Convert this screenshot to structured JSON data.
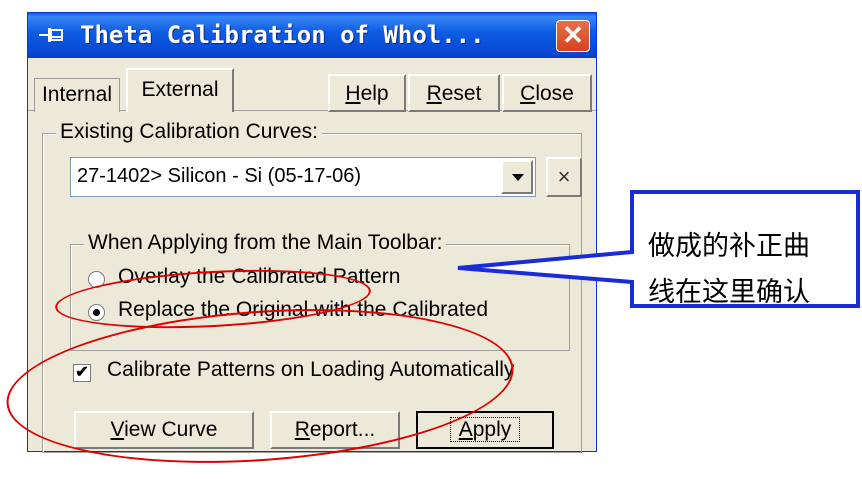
{
  "window": {
    "title": "Theta Calibration of Whol...",
    "close_glyph": "✕"
  },
  "tabs": [
    {
      "label": "Internal",
      "active": false
    },
    {
      "label": "External",
      "active": true
    }
  ],
  "toolbar": {
    "help": {
      "label_underline": "H",
      "label_rest": "elp"
    },
    "reset": {
      "label_underline": "R",
      "label_rest": "eset"
    },
    "close": {
      "label_underline": "C",
      "label_rest": "lose"
    }
  },
  "existing_group": {
    "label": "Existing Calibration Curves:",
    "selected_curve": "27-1402> Silicon - Si (05-17-06)",
    "clear_glyph": "×"
  },
  "apply_group": {
    "label": "When Applying from the Main Toolbar:",
    "options": [
      {
        "label": "Overlay the Calibrated Pattern",
        "selected": false
      },
      {
        "label": "Replace the Original with the Calibrated",
        "selected": true
      }
    ]
  },
  "auto_calibrate": {
    "label": "Calibrate Patterns on Loading Automatically",
    "checked": true,
    "check_glyph": "✔"
  },
  "buttons": {
    "view_curve": {
      "label_underline": "V",
      "label_rest": "iew Curve"
    },
    "report": {
      "label_underline": "R",
      "label_rest": "eport..."
    },
    "apply": {
      "label_underline": "A",
      "label_rest": "pply"
    }
  },
  "annotation": {
    "lines": [
      "做成的补正曲",
      "线在这里确认"
    ],
    "callout_color": "#1a2bd8",
    "ellipse_color": "#e00000"
  }
}
